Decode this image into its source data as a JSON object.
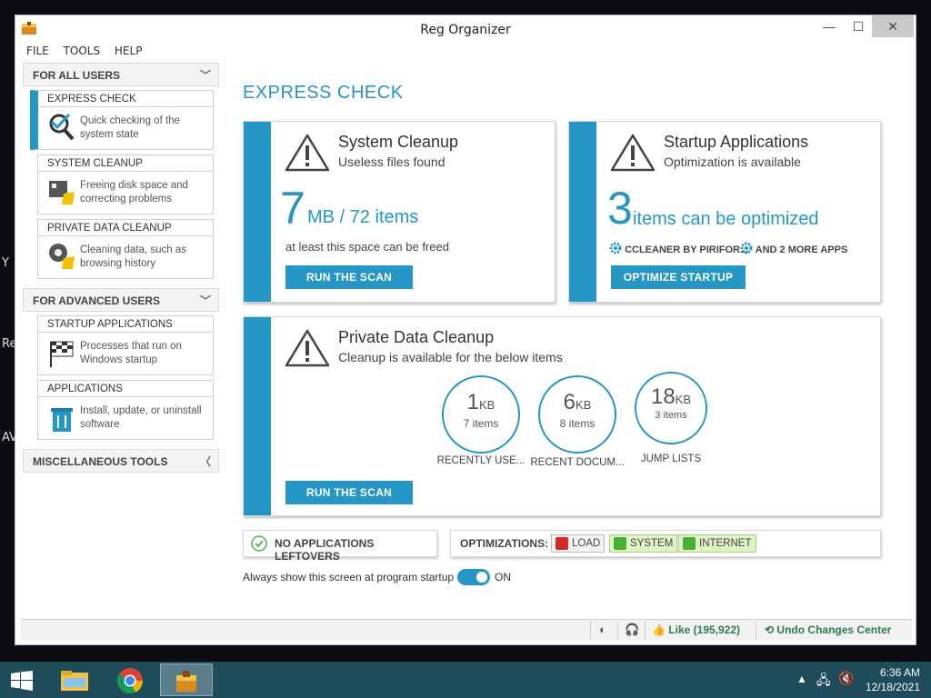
{
  "desktop_fragments": [
    "Y",
    "Re",
    "AV"
  ],
  "window": {
    "title": "Reg Organizer",
    "controls": {
      "minimize": "—",
      "maximize": "☐",
      "close": "✕"
    }
  },
  "menu": [
    "FILE",
    "TOOLS",
    "HELP"
  ],
  "sidebar": {
    "for_all_users": "FOR ALL USERS",
    "for_advanced_users": "FOR ADVANCED USERS",
    "misc_tools": "MISCELLANEOUS TOOLS",
    "items": [
      {
        "title": "EXPRESS CHECK",
        "desc": "Quick checking of the system state",
        "icon": "magnifier-check-icon"
      },
      {
        "title": "SYSTEM CLEANUP",
        "desc": "Freeing disk space and correcting problems",
        "icon": "disk-broom-icon"
      },
      {
        "title": "PRIVATE DATA CLEANUP",
        "desc": "Cleaning data, such as browsing history",
        "icon": "privacy-broom-icon"
      },
      {
        "title": "STARTUP APPLICATIONS",
        "desc": "Processes that run on Windows startup",
        "icon": "checkered-flag-icon"
      },
      {
        "title": "APPLICATIONS",
        "desc": "Install, update, or uninstall software",
        "icon": "trash-box-icon"
      }
    ]
  },
  "main": {
    "page_title": "EXPRESS CHECK",
    "system_cleanup": {
      "title": "System Cleanup",
      "subtitle": "Useless files found",
      "number": "7",
      "unit": "MB / 72 items",
      "note": "at least this space can be freed",
      "button": "RUN THE SCAN"
    },
    "startup": {
      "title": "Startup Applications",
      "subtitle": "Optimization is available",
      "number": "3",
      "unit": "items can be optimized",
      "app1": "CCLEANER BY PIRIFOR...",
      "app2": "AND 2 MORE APPS",
      "button": "OPTIMIZE STARTUP"
    },
    "private": {
      "title": "Private Data Cleanup",
      "subtitle": "Cleanup is available for the below items",
      "button": "RUN THE SCAN",
      "circles": [
        {
          "value": "1",
          "unit": "KB",
          "items": "7 items",
          "label": "RECENTLY USE..."
        },
        {
          "value": "6",
          "unit": "KB",
          "items": "8 items",
          "label": "RECENT DOCUM..."
        },
        {
          "value": "18",
          "unit": "KB",
          "items": "3 items",
          "label": "JUMP LISTS"
        }
      ]
    },
    "leftovers": "NO APPLICATIONS LEFTOVERS",
    "optimizations_label": "OPTIMIZATIONS:",
    "optimizations": [
      {
        "label": "LOAD",
        "state": "off"
      },
      {
        "label": "SYSTEM",
        "state": "on"
      },
      {
        "label": "INTERNET",
        "state": "on"
      }
    ],
    "startup_toggle_label": "Always show this screen at program startup",
    "startup_toggle_state": "ON"
  },
  "statusbar": {
    "like": "Like (195,922)",
    "undo": "Undo Changes Center"
  },
  "taskbar": {
    "time": "6:36 AM",
    "date": "12/18/2021"
  },
  "colors": {
    "accent": "#2697c4",
    "status_green": "#2e7d4a",
    "taskbar": "#1e4c5a"
  }
}
